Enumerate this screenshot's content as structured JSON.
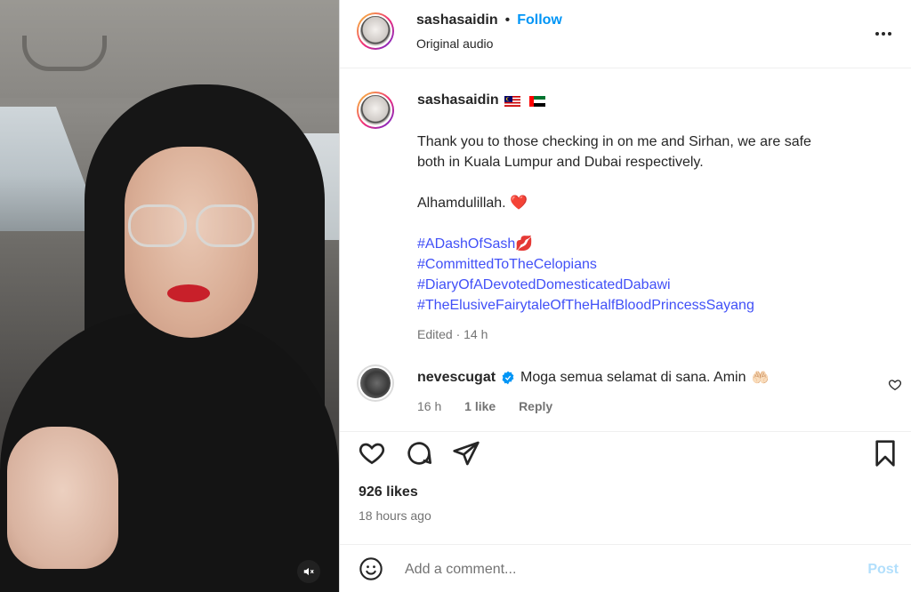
{
  "header": {
    "username": "sashasaidin",
    "separator": "•",
    "follow_label": "Follow",
    "subtitle": "Original audio"
  },
  "caption": {
    "username": "sashasaidin",
    "flags": [
      "malaysia-flag",
      "uae-flag"
    ],
    "text_line1": "Thank you to those checking in on me and Sirhan, we are safe",
    "text_line2": "both in Kuala Lumpur and Dubai respectively.",
    "text_line3": "Alhamdulillah.",
    "heart_emoji": "❤️",
    "hashtags": [
      "#ADashOfSash",
      "#CommittedToTheCelopians",
      "#DiaryOfADevotedDomesticatedDabawi",
      "#TheElusiveFairytaleOfTheHalfBloodPrincessSayang"
    ],
    "kiss_emoji": "💋",
    "meta": "Edited · 14 h"
  },
  "comment": {
    "username": "nevescugat",
    "text": "Moga semua selamat di sana. Amin",
    "emoji": "🤲🏻",
    "time": "16 h",
    "likes": "1 like",
    "reply_label": "Reply"
  },
  "stats": {
    "likes": "926 likes",
    "time": "18 hours ago"
  },
  "comment_bar": {
    "placeholder": "Add a comment...",
    "post_label": "Post"
  },
  "colors": {
    "accent": "#0095f6",
    "hashtag": "#4150f7",
    "heart": "#e0245e",
    "verified": "#0095f6",
    "post_disabled": "#b2dffc"
  }
}
